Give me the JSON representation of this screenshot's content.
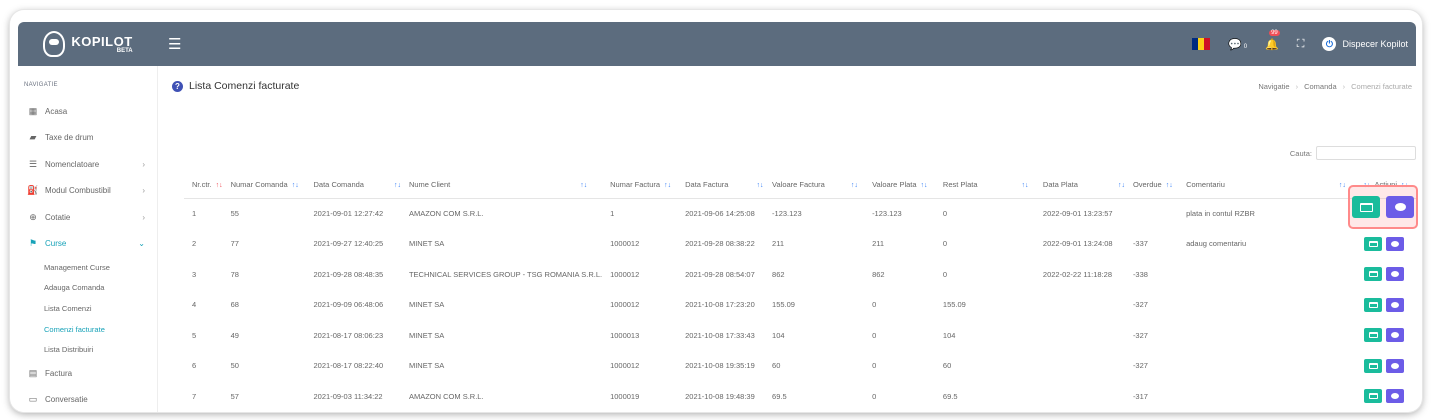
{
  "header": {
    "brand": "KOPILOT",
    "beta": "BETA",
    "chat_count": "0",
    "notif_count": "99",
    "user": "Dispecer Kopilot"
  },
  "sidebar": {
    "section": "NAVIGATIE",
    "items": [
      {
        "label": "Acasa",
        "icon": "grid-icon"
      },
      {
        "label": "Taxe de drum",
        "icon": "ticket-icon"
      },
      {
        "label": "Nomenclatoare",
        "icon": "list-icon",
        "chevron": "›"
      },
      {
        "label": "Modul Combustibil",
        "icon": "fuel-icon",
        "chevron": "›"
      },
      {
        "label": "Cotatie",
        "icon": "globe-icon",
        "chevron": "›"
      },
      {
        "label": "Curse",
        "icon": "flag-icon",
        "chevron": "⌄"
      }
    ],
    "sub_items": [
      "Management Curse",
      "Adauga Comanda",
      "Lista Comenzi",
      "Comenzi facturate",
      "Lista Distribuiri"
    ],
    "bottom_items": [
      {
        "label": "Factura",
        "icon": "document-icon"
      },
      {
        "label": "Conversatie",
        "icon": "chat-icon"
      }
    ]
  },
  "page": {
    "title": "Lista Comenzi facturate",
    "breadcrumb": [
      "Navigatie",
      "Comanda",
      "Comenzi facturate"
    ],
    "search_label": "Cauta:"
  },
  "table": {
    "headers": [
      "Nr.ctr.",
      "Numar Comanda",
      "Data Comanda",
      "Nume Client",
      "Numar Factura",
      "Data Factura",
      "Valoare Factura",
      "Valoare Plata",
      "Rest Plata",
      "Data Plata",
      "Overdue",
      "Comentariu",
      "Actiuni"
    ],
    "rows": [
      [
        "1",
        "55",
        "2021-09-01 12:27:42",
        "AMAZON COM S.R.L.",
        "1",
        "2021-09-06 14:25:08",
        "-123.123",
        "-123.123",
        "0",
        "2022-09-01 13:23:57",
        "",
        "plata in contul RZBR"
      ],
      [
        "2",
        "77",
        "2021-09-27 12:40:25",
        "MINET SA",
        "1000012",
        "2021-09-28 08:38:22",
        "211",
        "211",
        "0",
        "2022-09-01 13:24:08",
        "-337",
        "adaug comentariu"
      ],
      [
        "3",
        "78",
        "2021-09-28 08:48:35",
        "TECHNICAL SERVICES GROUP - TSG ROMANIA S.R.L.",
        "1000012",
        "2021-09-28 08:54:07",
        "862",
        "862",
        "0",
        "2022-02-22 11:18:28",
        "-338",
        ""
      ],
      [
        "4",
        "68",
        "2021-09-09 06:48:06",
        "MINET SA",
        "1000012",
        "2021-10-08 17:23:20",
        "155.09",
        "0",
        "155.09",
        "",
        "-327",
        ""
      ],
      [
        "5",
        "49",
        "2021-08-17 08:06:23",
        "MINET SA",
        "1000013",
        "2021-10-08 17:33:43",
        "104",
        "0",
        "104",
        "",
        "-327",
        ""
      ],
      [
        "6",
        "50",
        "2021-08-17 08:22:40",
        "MINET SA",
        "1000012",
        "2021-10-08 19:35:19",
        "60",
        "0",
        "60",
        "",
        "-327",
        ""
      ],
      [
        "7",
        "57",
        "2021-09-03 11:34:22",
        "AMAZON COM S.R.L.",
        "1000019",
        "2021-10-08 19:48:39",
        "69.5",
        "0",
        "69.5",
        "",
        "-317",
        ""
      ]
    ]
  },
  "colors": {
    "topbar": "#5c6c7e",
    "accent": "#17a2b8",
    "btn_green": "#1abc9c",
    "btn_purple": "#6c5ce7"
  }
}
